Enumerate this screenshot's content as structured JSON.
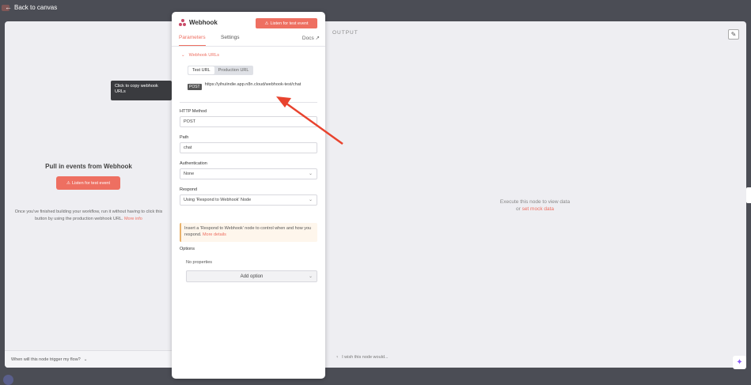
{
  "nav": {
    "back_label": "Back to canvas"
  },
  "input_panel": {
    "title": "Pull in events from Webhook",
    "listen_button": "Listen for test event",
    "description": "Once you've finished building your workflow, run it without having to click this button by using the production webhook URL.",
    "more_info": "More info",
    "trigger_question": "When will this node trigger my flow?"
  },
  "node": {
    "name": "Webhook",
    "listen_button": "Listen for test event",
    "tabs": [
      "Parameters",
      "Settings"
    ],
    "active_tab": "Parameters",
    "docs_label": "Docs",
    "webhook_urls": {
      "section_label": "Webhook URLs",
      "tabs": [
        "Test URL",
        "Production URL"
      ],
      "active_tab": "Test URL",
      "method_badge": "POST",
      "url": "https://yihuiindie.app.n8n.cloud/webhook-test/chat"
    },
    "tooltip": "Click to copy webhook URLs",
    "http_method": {
      "label": "HTTP Method",
      "value": "POST"
    },
    "path": {
      "label": "Path",
      "value": "chat"
    },
    "authentication": {
      "label": "Authentication",
      "value": "None"
    },
    "respond": {
      "label": "Respond",
      "value": "Using 'Respond to Webhook' Node"
    },
    "notice": {
      "text": "Insert a 'Respond to Webhook' node to control when and how you respond.",
      "link": "More details"
    },
    "options": {
      "label": "Options",
      "empty": "No properties",
      "add_button": "Add option"
    }
  },
  "output_panel": {
    "label": "OUTPUT",
    "empty_text": "Execute this node to view data",
    "or_label": "or",
    "mock_link": "set mock data",
    "wish_text": "I wish this node would..."
  },
  "colors": {
    "accent": "#ee6f61",
    "backdrop": "#4b4d55",
    "panel": "#eeeef2",
    "annotation_arrow": "#e8432e"
  },
  "icons": [
    "back-arrow-icon",
    "webhook-icon",
    "alert-icon",
    "external-link-icon",
    "chevron-down-icon",
    "pencil-icon",
    "sparkle-icon",
    "lightbulb-icon"
  ]
}
